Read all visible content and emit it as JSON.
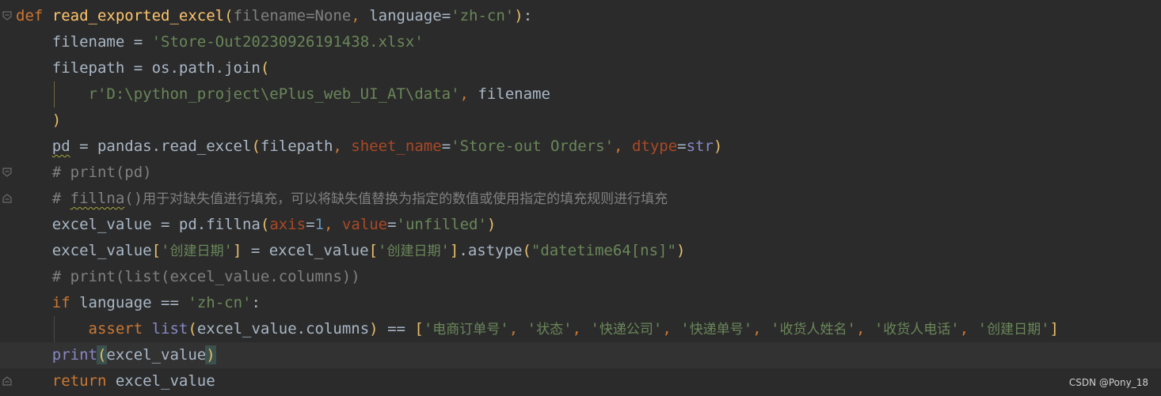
{
  "watermark": "CSDN @Pony_18",
  "icons": {
    "fold_open": "fold-open-icon",
    "fold_close": "fold-close-icon"
  },
  "colors": {
    "background": "#2b2b2b",
    "keyword": "#cc7832",
    "function": "#ffc66d",
    "string": "#6a8759",
    "comment": "#808080",
    "number": "#6897bb",
    "builtin": "#8888c6",
    "kwarg": "#aa4926",
    "default": "#a9b7c6"
  },
  "lines": [
    [
      {
        "t": "def",
        "c": "kw"
      },
      {
        "t": " "
      },
      {
        "t": "read_exported_excel",
        "c": "fn"
      },
      {
        "t": "(",
        "c": "paren"
      },
      {
        "t": "filename=None",
        "c": "param"
      },
      {
        "t": ", ",
        "c": "kw"
      },
      {
        "t": "language"
      },
      {
        "t": "="
      },
      {
        "t": "'zh-cn'",
        "c": "str"
      },
      {
        "t": ")",
        "c": "paren"
      },
      {
        "t": ":"
      }
    ],
    [
      {
        "t": "    filename = "
      },
      {
        "t": "'Store-Out20230926191438.xlsx'",
        "c": "str"
      }
    ],
    [
      {
        "t": "    filepath = os.path.join"
      },
      {
        "t": "(",
        "c": "paren"
      }
    ],
    [
      {
        "t": "        "
      },
      {
        "t": "r'D:\\python_project\\ePlus_web_UI_AT\\data'",
        "c": "str"
      },
      {
        "t": ", ",
        "c": "kw"
      },
      {
        "t": "filename"
      }
    ],
    [
      {
        "t": "    "
      },
      {
        "t": ")",
        "c": "paren"
      }
    ],
    [
      {
        "t": "    "
      },
      {
        "t": "pd",
        "c": "squigtok"
      },
      {
        "t": " = pandas.read_excel"
      },
      {
        "t": "(",
        "c": "paren"
      },
      {
        "t": "filepath"
      },
      {
        "t": ", ",
        "c": "kw"
      },
      {
        "t": "sheet_name",
        "c": "kwarg"
      },
      {
        "t": "="
      },
      {
        "t": "'Store-out Orders'",
        "c": "str"
      },
      {
        "t": ", ",
        "c": "kw"
      },
      {
        "t": "dtype",
        "c": "kwarg"
      },
      {
        "t": "="
      },
      {
        "t": "str",
        "c": "builtin"
      },
      {
        "t": ")",
        "c": "paren"
      }
    ],
    [
      {
        "t": "    # print(pd)",
        "c": "comment"
      }
    ],
    [
      {
        "t": "    # ",
        "c": "comment"
      },
      {
        "t": "fillna",
        "c": "commentsquig"
      },
      {
        "t": "()",
        "c": "comment"
      },
      {
        "t": "用于对缺失值进行填充，可以将缺失值替换为指定的数值或使用指定的填充规则进行填充",
        "c": "commentcjk"
      }
    ],
    [
      {
        "t": "    excel_value = pd.fillna"
      },
      {
        "t": "(",
        "c": "paren"
      },
      {
        "t": "axis",
        "c": "kwarg"
      },
      {
        "t": "="
      },
      {
        "t": "1",
        "c": "num"
      },
      {
        "t": ", ",
        "c": "kw"
      },
      {
        "t": "value",
        "c": "kwarg"
      },
      {
        "t": "="
      },
      {
        "t": "'unfilled'",
        "c": "str"
      },
      {
        "t": ")",
        "c": "paren"
      }
    ],
    [
      {
        "t": "    excel_value"
      },
      {
        "t": "[",
        "c": "paren"
      },
      {
        "t": "'",
        "c": "str"
      },
      {
        "t": "创建日期",
        "c": "strcjk"
      },
      {
        "t": "'",
        "c": "str"
      },
      {
        "t": "]",
        "c": "paren"
      },
      {
        "t": " = excel_value"
      },
      {
        "t": "[",
        "c": "paren"
      },
      {
        "t": "'",
        "c": "str"
      },
      {
        "t": "创建日期",
        "c": "strcjk"
      },
      {
        "t": "'",
        "c": "str"
      },
      {
        "t": "]",
        "c": "paren"
      },
      {
        "t": ".astype"
      },
      {
        "t": "(",
        "c": "paren"
      },
      {
        "t": "\"datetime64[ns]\"",
        "c": "str"
      },
      {
        "t": ")",
        "c": "paren"
      }
    ],
    [
      {
        "t": "    # print(list(excel_value.columns))",
        "c": "comment"
      }
    ],
    [
      {
        "t": "    "
      },
      {
        "t": "if",
        "c": "kw"
      },
      {
        "t": " language == "
      },
      {
        "t": "'zh-cn'",
        "c": "str"
      },
      {
        "t": ":"
      }
    ],
    [
      {
        "t": "        "
      },
      {
        "t": "assert",
        "c": "kw"
      },
      {
        "t": " "
      },
      {
        "t": "list",
        "c": "builtin"
      },
      {
        "t": "(",
        "c": "paren"
      },
      {
        "t": "excel_value.columns"
      },
      {
        "t": ")",
        "c": "paren"
      },
      {
        "t": " == "
      },
      {
        "t": "[",
        "c": "paren"
      },
      {
        "t": "'",
        "c": "str"
      },
      {
        "t": "电商订单号",
        "c": "strcjk"
      },
      {
        "t": "'",
        "c": "str"
      },
      {
        "t": ", ",
        "c": "kw"
      },
      {
        "t": "'",
        "c": "str"
      },
      {
        "t": "状态",
        "c": "strcjk"
      },
      {
        "t": "'",
        "c": "str"
      },
      {
        "t": ", ",
        "c": "kw"
      },
      {
        "t": "'",
        "c": "str"
      },
      {
        "t": "快递公司",
        "c": "strcjk"
      },
      {
        "t": "'",
        "c": "str"
      },
      {
        "t": ", ",
        "c": "kw"
      },
      {
        "t": "'",
        "c": "str"
      },
      {
        "t": "快递单号",
        "c": "strcjk"
      },
      {
        "t": "'",
        "c": "str"
      },
      {
        "t": ", ",
        "c": "kw"
      },
      {
        "t": "'",
        "c": "str"
      },
      {
        "t": "收货人姓名",
        "c": "strcjk"
      },
      {
        "t": "'",
        "c": "str"
      },
      {
        "t": ", ",
        "c": "kw"
      },
      {
        "t": "'",
        "c": "str"
      },
      {
        "t": "收货人电话",
        "c": "strcjk"
      },
      {
        "t": "'",
        "c": "str"
      },
      {
        "t": ", ",
        "c": "kw"
      },
      {
        "t": "'",
        "c": "str"
      },
      {
        "t": "创建日期",
        "c": "strcjk"
      },
      {
        "t": "'",
        "c": "str"
      },
      {
        "t": "]",
        "c": "paren"
      }
    ],
    [
      {
        "t": "    "
      },
      {
        "t": "print",
        "c": "builtin"
      },
      {
        "t": "(",
        "c": "parenmatch"
      },
      {
        "t": "excel_value"
      },
      {
        "t": ")",
        "c": "parenmatch"
      }
    ],
    [
      {
        "t": "    "
      },
      {
        "t": "return",
        "c": "kw"
      },
      {
        "t": " excel_value"
      }
    ]
  ]
}
